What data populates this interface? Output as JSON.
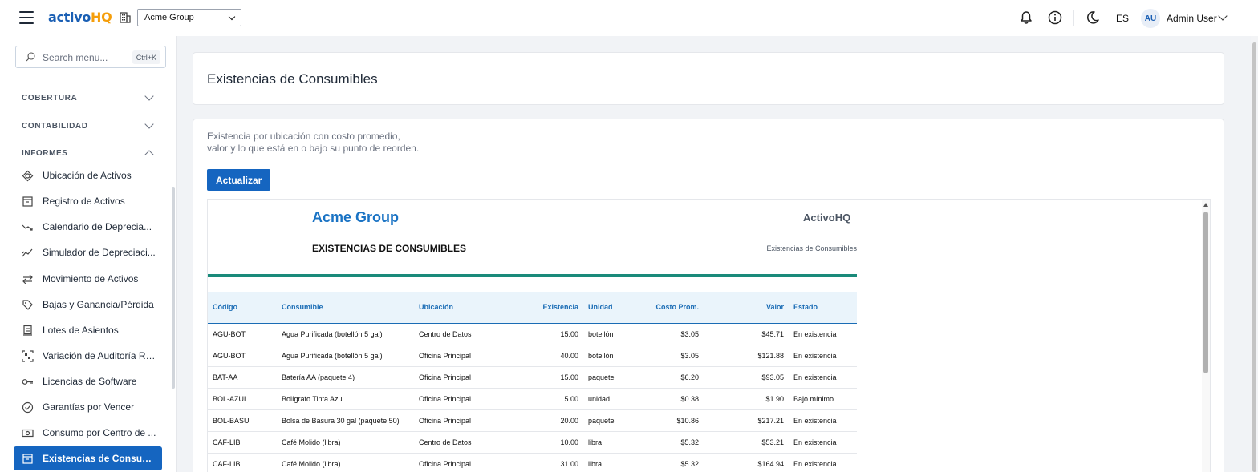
{
  "header": {
    "brand_part1": "activo",
    "brand_part2": "HQ",
    "org_selected": "Acme Group",
    "lang": "ES",
    "avatar_initials": "AU",
    "user_name": "Admin User"
  },
  "sidebar": {
    "search_placeholder": "Search menu...",
    "search_shortcut": "Ctrl+K",
    "sections": [
      {
        "label": "COBERTURA",
        "expanded": false
      },
      {
        "label": "CONTABILIDAD",
        "expanded": false
      },
      {
        "label": "INFORMES",
        "expanded": true
      }
    ],
    "items": [
      {
        "label": "Ubicación de Activos",
        "icon": "location-icon"
      },
      {
        "label": "Registro de Activos",
        "icon": "archive-icon"
      },
      {
        "label": "Calendario de Deprecia...",
        "icon": "trend-down-icon"
      },
      {
        "label": "Simulador de Depreciaci...",
        "icon": "trend-line-icon"
      },
      {
        "label": "Movimiento de Activos",
        "icon": "swap-icon"
      },
      {
        "label": "Bajas y Ganancia/Pérdida",
        "icon": "tag-icon"
      },
      {
        "label": "Lotes de Asientos",
        "icon": "receipt-icon"
      },
      {
        "label": "Variación de Auditoría RF...",
        "icon": "scan-icon"
      },
      {
        "label": "Licencias de Software",
        "icon": "key-icon"
      },
      {
        "label": "Garantías por Vencer",
        "icon": "badge-check-icon"
      },
      {
        "label": "Consumo por Centro de ...",
        "icon": "cash-icon"
      },
      {
        "label": "Existencias de Consumi...",
        "icon": "box-icon",
        "active": true
      }
    ]
  },
  "page": {
    "title": "Existencias de Consumibles",
    "description_line1": "Existencia por ubicación con costo promedio,",
    "description_line2": "valor y lo que está en o bajo su punto de reorden.",
    "refresh_label": "Actualizar"
  },
  "report": {
    "company": "Acme Group",
    "brand": "ActivoHQ",
    "title": "EXISTENCIAS DE CONSUMIBLES",
    "subtitle": "Existencias de Consumibles",
    "columns": [
      "Código",
      "Consumible",
      "Ubicación",
      "Existencia",
      "Unidad",
      "Costo Prom.",
      "Valor",
      "Estado"
    ],
    "rows": [
      [
        "AGU-BOT",
        "Agua Purificada (botellón 5 gal)",
        "Centro de Datos",
        "15.00",
        "botellón",
        "$3.05",
        "$45.71",
        "En existencia"
      ],
      [
        "AGU-BOT",
        "Agua Purificada (botellón 5 gal)",
        "Oficina Principal",
        "40.00",
        "botellón",
        "$3.05",
        "$121.88",
        "En existencia"
      ],
      [
        "BAT-AA",
        "Batería AA (paquete 4)",
        "Oficina Principal",
        "15.00",
        "paquete",
        "$6.20",
        "$93.05",
        "En existencia"
      ],
      [
        "BOL-AZUL",
        "Bolígrafo Tinta Azul",
        "Oficina Principal",
        "5.00",
        "unidad",
        "$0.38",
        "$1.90",
        "Bajo mínimo"
      ],
      [
        "BOL-BASU",
        "Bolsa de Basura 30 gal (paquete 50)",
        "Oficina Principal",
        "20.00",
        "paquete",
        "$10.86",
        "$217.21",
        "En existencia"
      ],
      [
        "CAF-LIB",
        "Café Molido (libra)",
        "Centro de Datos",
        "10.00",
        "libra",
        "$5.32",
        "$53.21",
        "En existencia"
      ],
      [
        "CAF-LIB",
        "Café Molido (libra)",
        "Oficina Principal",
        "31.00",
        "libra",
        "$5.32",
        "$164.94",
        "En existencia"
      ]
    ]
  }
}
